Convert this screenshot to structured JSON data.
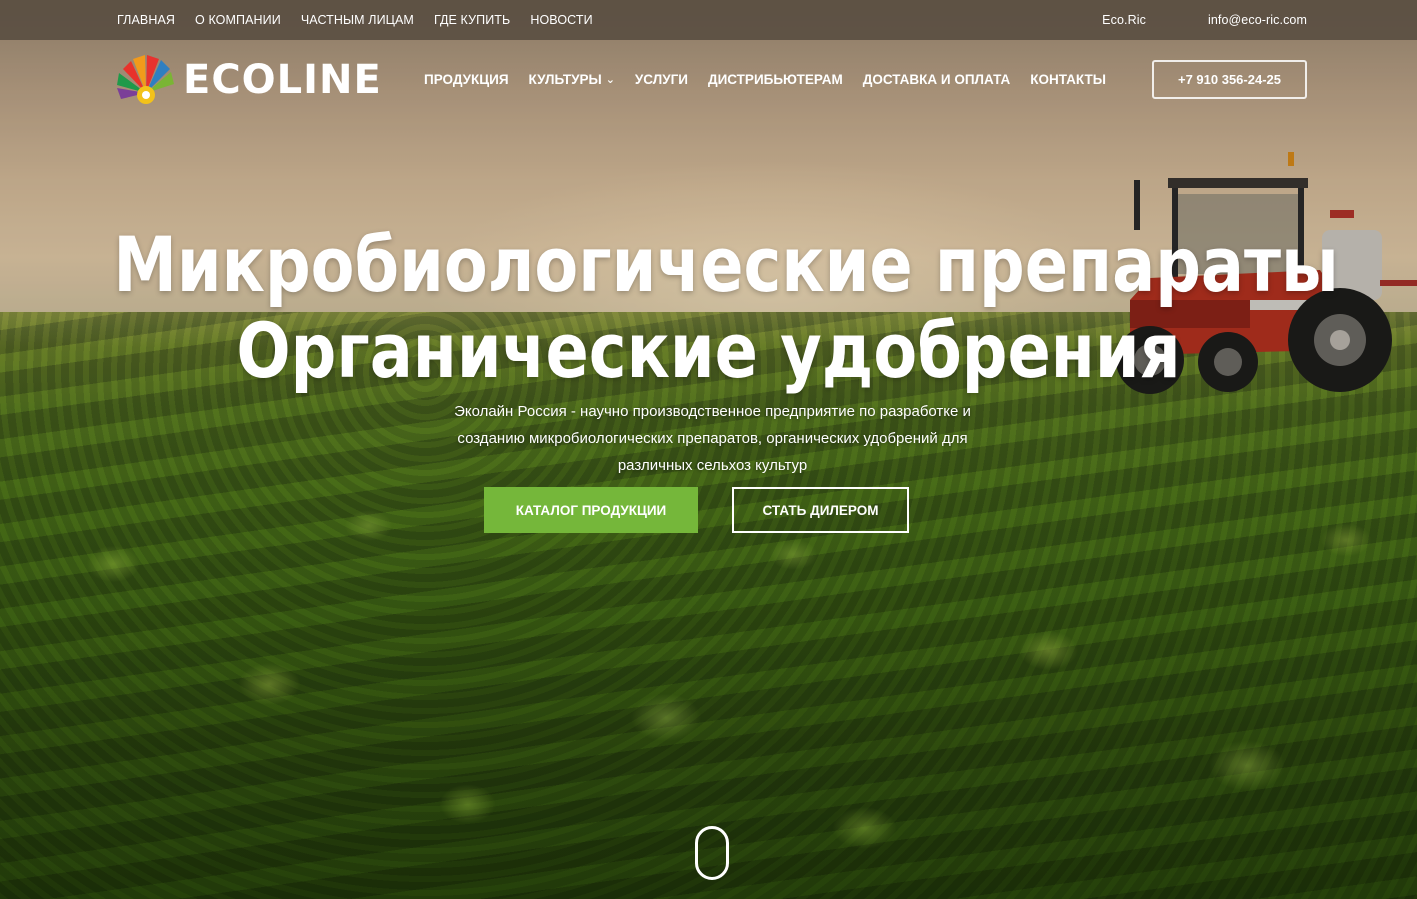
{
  "topbar": {
    "links": [
      "ГЛАВНАЯ",
      "О КОМПАНИИ",
      "ЧАСТНЫМ ЛИЦАМ",
      "ГДЕ КУПИТЬ",
      "НОВОСТИ"
    ],
    "brand_link": "Eco.Ric",
    "email": "info@eco-ric.com"
  },
  "header": {
    "logo_text": "ECOLINE",
    "nav": {
      "products": "ПРОДУКЦИЯ",
      "cultures": "КУЛЬТУРЫ",
      "services": "УСЛУГИ",
      "distributors": "ДИСТРИБЬЮТЕРАМ",
      "delivery": "ДОСТАВКА И ОПЛАТА",
      "contacts": "КОНТАКТЫ"
    },
    "phone": "+7 910 356-24-25"
  },
  "hero": {
    "title_line1": "Микробиологические препараты",
    "title_line2": "Органические удобрения",
    "subtitle": "Эколайн Россия - научно производственное предприятие по разработке и созданию микробиологических препаратов, органических удобрений для различных сельхоз культур",
    "catalog_button": "КАТАЛОГ ПРОДУКЦИИ",
    "dealer_button": "СТАТЬ ДИЛЕРОМ"
  },
  "colors": {
    "accent_green": "#75b73a",
    "topbar_bg": "#584c40"
  },
  "icons": {
    "dropdown": "chevron-down-icon",
    "scroll": "scroll-mouse-icon",
    "logo": "ecoline-logo-icon"
  }
}
